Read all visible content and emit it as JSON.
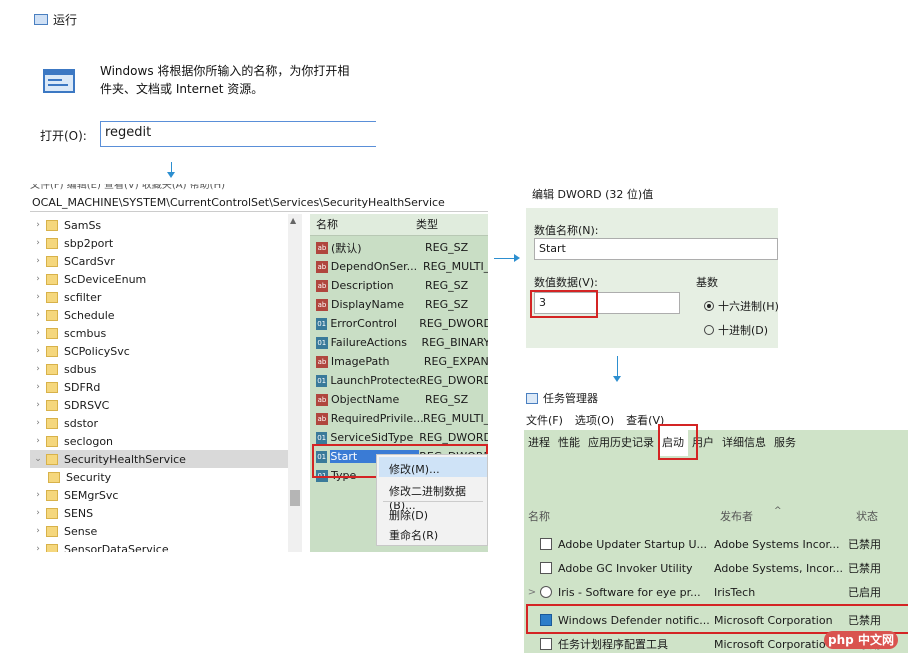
{
  "run": {
    "title": "运行",
    "description_line1": "Windows 将根据你所输入的名称，为你打开相",
    "description_line2": "件夹、文档或 Internet 资源。",
    "open_label": "打开(O):",
    "input_value": "regedit"
  },
  "registry": {
    "menu": "文件(F) 编辑(E) 查看(V) 收藏夹(A) 帮助(H)",
    "address": "OCAL_MACHINE\\SYSTEM\\CurrentControlSet\\Services\\SecurityHealthService",
    "tree": [
      "SamSs",
      "sbp2port",
      "SCardSvr",
      "ScDeviceEnum",
      "scfilter",
      "Schedule",
      "scmbus",
      "SCPolicySvc",
      "sdbus",
      "SDFRd",
      "SDRSVC",
      "sdstor",
      "seclogon",
      "SecurityHealthService",
      "Security",
      "SEMgrSvc",
      "SENS",
      "Sense",
      "SensorDataService"
    ],
    "value_headers": {
      "name": "名称",
      "type": "类型"
    },
    "values": [
      {
        "icon": "ab",
        "name": "(默认)",
        "type": "REG_SZ"
      },
      {
        "icon": "ab",
        "name": "DependOnSer...",
        "type": "REG_MULTI_"
      },
      {
        "icon": "ab",
        "name": "Description",
        "type": "REG_SZ"
      },
      {
        "icon": "ab",
        "name": "DisplayName",
        "type": "REG_SZ"
      },
      {
        "icon": "01",
        "name": "ErrorControl",
        "type": "REG_DWORD"
      },
      {
        "icon": "01",
        "name": "FailureActions",
        "type": "REG_BINARY"
      },
      {
        "icon": "ab",
        "name": "ImagePath",
        "type": "REG_EXPAN"
      },
      {
        "icon": "01",
        "name": "LaunchProtected",
        "type": "REG_DWORD"
      },
      {
        "icon": "ab",
        "name": "ObjectName",
        "type": "REG_SZ"
      },
      {
        "icon": "ab",
        "name": "RequiredPrivile...",
        "type": "REG_MULTI_"
      },
      {
        "icon": "01",
        "name": "ServiceSidType",
        "type": "REG_DWORD"
      },
      {
        "icon": "01",
        "name": "Start",
        "type": "REG_DWORD"
      },
      {
        "icon": "01",
        "name": "Type",
        "type": ""
      }
    ],
    "context_menu": {
      "modify": "修改(M)...",
      "modify_binary": "修改二进制数据(B)...",
      "delete": "删除(D)",
      "rename": "重命名(R)"
    }
  },
  "dword": {
    "title": "编辑 DWORD (32 位)值",
    "name_label": "数值名称(N):",
    "name_value": "Start",
    "data_label": "数值数据(V):",
    "data_value": "3",
    "base_label": "基数",
    "hex_label": "十六进制(H)",
    "dec_label": "十进制(D)"
  },
  "taskmgr": {
    "title": "任务管理器",
    "menu": [
      "文件(F)",
      "选项(O)",
      "查看(V)"
    ],
    "tabs": [
      "进程",
      "性能",
      "应用历史记录",
      "启动",
      "用户",
      "详细信息",
      "服务"
    ],
    "active_tab": "启动",
    "columns": {
      "name": "名称",
      "publisher": "发布者",
      "status": "状态"
    },
    "rows": [
      {
        "expand": "",
        "icon": "adobe-updater-icon",
        "name": "Adobe Updater Startup U...",
        "publisher": "Adobe Systems Incor...",
        "status": "已禁用"
      },
      {
        "expand": "",
        "icon": "adobe-gc-icon",
        "name": "Adobe GC Invoker Utility",
        "publisher": "Adobe Systems, Incor...",
        "status": "已禁用"
      },
      {
        "expand": ">",
        "icon": "iris-icon",
        "name": "Iris - Software for eye pr...",
        "publisher": "IrisTech",
        "status": "已启用"
      },
      {
        "expand": "",
        "icon": "defender-shield-icon",
        "name": "Windows Defender notific...",
        "publisher": "Microsoft Corporation",
        "status": "已禁用"
      },
      {
        "expand": "",
        "icon": "task-scheduler-icon",
        "name": "任务计划程序配置工具",
        "publisher": "Microsoft Corporatio",
        "status": "已禁用"
      }
    ]
  },
  "watermark": "php 中文网",
  "colors": {
    "highlight_red": "#d42424",
    "accent_green": "#cfe3c8",
    "arrow_blue": "#2d8fd0"
  }
}
